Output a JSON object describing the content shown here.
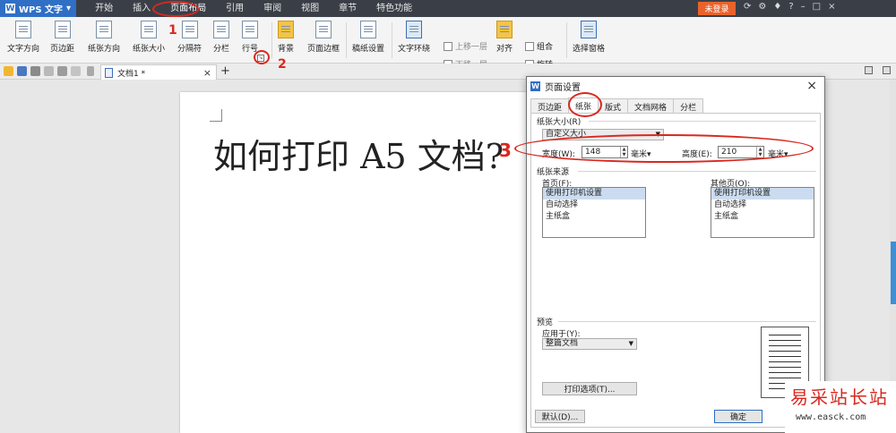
{
  "app": {
    "name": "WPS 文字",
    "menu_tabs": [
      "开始",
      "插入",
      "页面布局",
      "引用",
      "审阅",
      "视图",
      "章节",
      "特色功能"
    ],
    "login_label": "未登录"
  },
  "ribbon": {
    "text_direction": "文字方向",
    "margins": "页边距",
    "orientation": "纸张方向",
    "paper_size": "纸张大小",
    "breaks": "分隔符",
    "columns": "分栏",
    "line_numbers": "行号",
    "background": "背景",
    "page_border": "页面边框",
    "manuscript": "稿纸设置",
    "text_wrap": "文字环绕",
    "bring_forward": "上移一层",
    "send_backward": "下移一层",
    "align": "对齐",
    "group": "组合",
    "rotate": "旋转",
    "selection_pane": "选择窗格"
  },
  "toolbar": {
    "doc_tab_title": "文档1 *",
    "add_tab": "+",
    "close_tab": "×"
  },
  "document": {
    "body_text": "如何打印 A5 文档?"
  },
  "annotations": {
    "step1": "1",
    "step2": "2",
    "step3": "3"
  },
  "dialog": {
    "title": "页面设置",
    "tabs": [
      "页边距",
      "纸张",
      "版式",
      "文档网格",
      "分栏"
    ],
    "active_tab": "纸张",
    "paper_size_label": "纸张大小(R)",
    "paper_size_value": "自定义大小",
    "width_label": "宽度(W):",
    "width_value": "148",
    "width_unit": "毫米",
    "height_label": "高度(E):",
    "height_value": "210",
    "height_unit": "毫米",
    "paper_source_label": "纸张来源",
    "first_page_label": "首页(F):",
    "other_pages_label": "其他页(O):",
    "source_options": [
      "使用打印机设置",
      "自动选择",
      "主纸盒"
    ],
    "preview_label": "预览",
    "apply_to_label": "应用于(Y):",
    "apply_to_value": "整篇文档",
    "print_options_button": "打印选项(T)...",
    "default_button": "默认(D)...",
    "ok_button": "确定",
    "close_symbol": "×"
  },
  "watermark": {
    "site_name": "易采站长站",
    "site_url": "www.easck.com"
  },
  "colors": {
    "annotation": "#d9281f",
    "accent": "#2f6fc6",
    "titlebar": "#3a3f47"
  }
}
